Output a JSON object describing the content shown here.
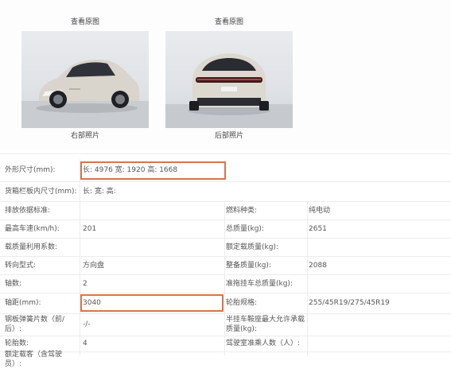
{
  "photos": [
    {
      "link_label": "查看原图",
      "caption": "右部照片"
    },
    {
      "link_label": "查看原图",
      "caption": "后部照片"
    }
  ],
  "specs": {
    "rows": [
      {
        "label": "外形尺寸(mm):",
        "value": "长: 4976 宽: 1920 高: 1668",
        "label2": "",
        "value2": "",
        "highlighted": true
      },
      {
        "label": "货箱栏板内尺寸(mm):",
        "value": "长:  宽:  高:",
        "label2": "",
        "value2": ""
      },
      {
        "label": "排放依据标准:",
        "value": "",
        "label2": "燃料种类:",
        "value2": "纯电动"
      },
      {
        "label": "最高车速(km/h):",
        "value": "201",
        "label2": "总质量(kg):",
        "value2": "2651"
      },
      {
        "label": "载质量利用系数:",
        "value": "",
        "label2": "额定载质量(kg):",
        "value2": ""
      },
      {
        "label": "转向型式:",
        "value": "方向盘",
        "label2": "整备质量(kg):",
        "value2": "2088"
      },
      {
        "label": "轴数:",
        "value": "2",
        "label2": "准拖挂车总质量(kg):",
        "value2": ""
      },
      {
        "label": "轴距(mm):",
        "value": "3040",
        "label2": "轮胎规格:",
        "value2": "255/45R19/275/45R19",
        "highlighted": true
      },
      {
        "label": "钢板弹簧片数（前/后）:",
        "value": "-/-",
        "label2": "半挂车鞍座最大允许承载质量(kg):",
        "value2": ""
      },
      {
        "label": "轮胎数:",
        "value": "4",
        "label2": "驾驶室准乘人数（人）:",
        "value2": ""
      },
      {
        "label": "额定载客（含驾驶员）:",
        "value": "",
        "label2": "",
        "value2": ""
      }
    ]
  }
}
